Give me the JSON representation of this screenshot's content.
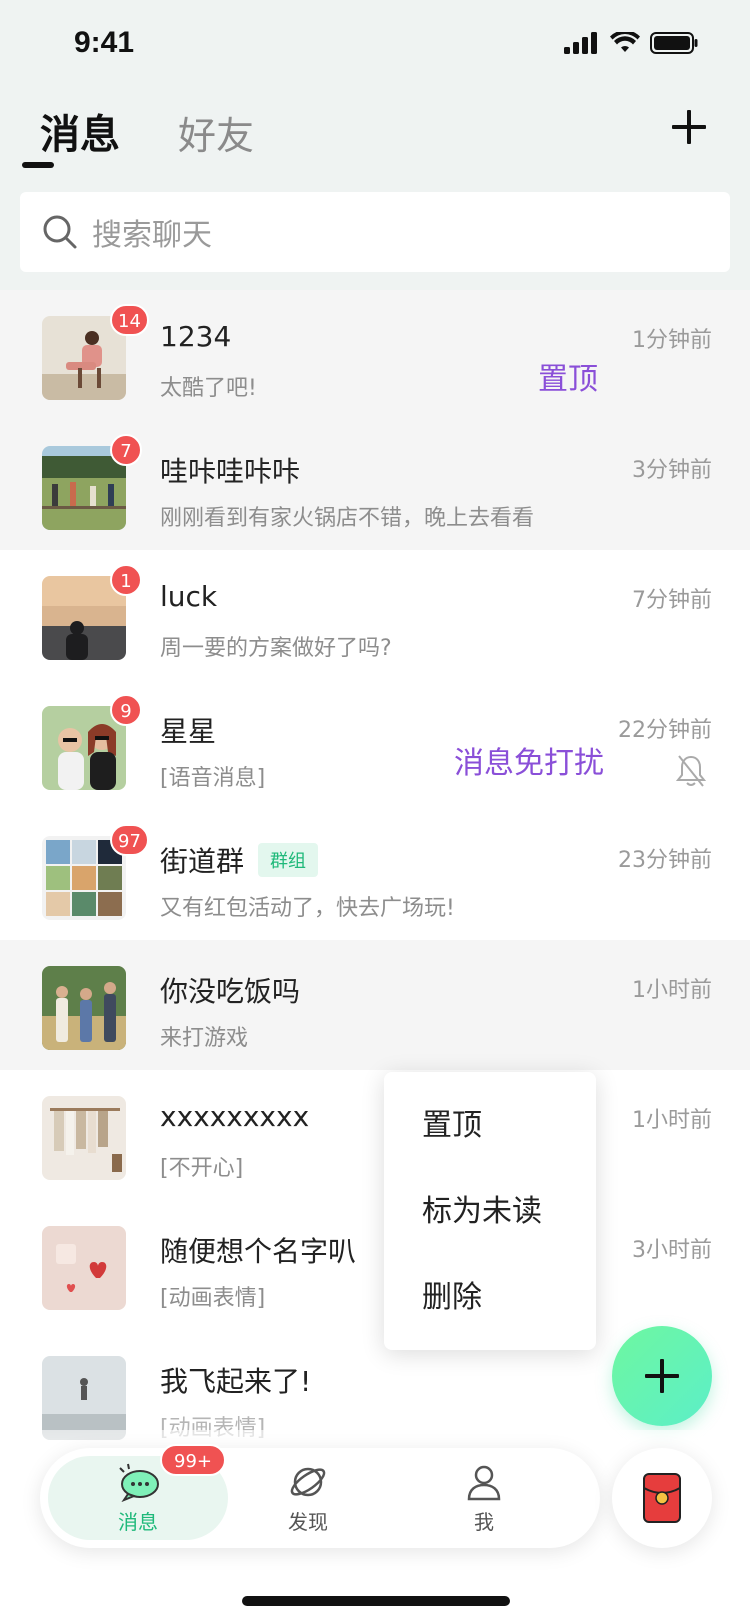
{
  "status_bar": {
    "time": "9:41"
  },
  "header": {
    "tabs": [
      {
        "label": "消息",
        "active": true
      },
      {
        "label": "好友",
        "active": false
      }
    ],
    "add_icon": "plus-icon"
  },
  "search": {
    "placeholder": "搜索聊天",
    "icon": "search-icon"
  },
  "conversations": [
    {
      "name": "1234",
      "preview": "太酷了吧!",
      "time": "1分钟前",
      "badge": "14",
      "pinned": true,
      "swipe_label": "置顶"
    },
    {
      "name": "哇咔哇咔咔",
      "preview": "刚刚看到有家火锅店不错，晚上去看看",
      "time": "3分钟前",
      "badge": "7",
      "pinned": true
    },
    {
      "name": "luck",
      "preview": "周一要的方案做好了吗?",
      "time": "7分钟前",
      "badge": "1",
      "pinned": false
    },
    {
      "name": "星星",
      "preview": "[语音消息]",
      "time": "22分钟前",
      "badge": "9",
      "pinned": false,
      "swipe_label": "消息免打扰",
      "muted": true
    },
    {
      "name": "街道群",
      "tag": "群组",
      "preview": "又有红包活动了，快去广场玩!",
      "time": "23分钟前",
      "badge": "97",
      "pinned": false
    },
    {
      "name": "你没吃饭吗",
      "preview": "来打游戏",
      "time": "1小时前",
      "pinned": true
    },
    {
      "name": "xxxxxxxxx",
      "preview": "[不开心]",
      "time": "1小时前",
      "pinned": false
    },
    {
      "name": "随便想个名字叭",
      "preview": "[动画表情]",
      "time": "3小时前",
      "pinned": false
    },
    {
      "name": "我飞起来了!",
      "preview": "[动画表情]",
      "time": "",
      "pinned": false
    }
  ],
  "context_menu": {
    "items": [
      "置顶",
      "标为未读",
      "删除"
    ]
  },
  "fab": {
    "icon": "plus-icon"
  },
  "tabbar": {
    "items": [
      {
        "label": "消息",
        "icon": "chat-bubble-icon",
        "active": true,
        "badge": "99+"
      },
      {
        "label": "发现",
        "icon": "planet-icon",
        "active": false
      },
      {
        "label": "我",
        "icon": "user-icon",
        "active": false
      }
    ],
    "extra_icon": "red-packet-icon"
  },
  "colors": {
    "accent": "#1fb97a",
    "badge": "#f05252",
    "swipe_text": "#8a4fd8",
    "header_bg": "#eff3f2"
  }
}
